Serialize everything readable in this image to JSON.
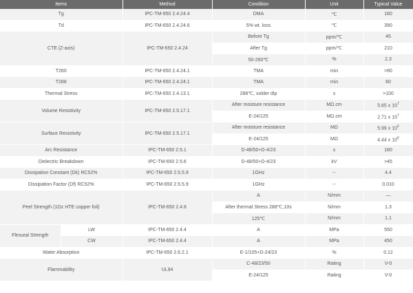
{
  "header": {
    "items": "Items",
    "method": "Method",
    "condition": "Condition",
    "unit": "Unit",
    "typical": "Typical Value"
  },
  "rows": {
    "tg": {
      "item": "Tg",
      "method": "IPC-TM-650 2.4.24.4",
      "condition": "DMA",
      "unit": "℃",
      "value": "180"
    },
    "td": {
      "item": "Td",
      "method": "IPC-TM-650 2.4.24.6",
      "condition": "5% wt. loss",
      "unit": "℃",
      "value": "390"
    },
    "cte": {
      "item": "CTE (Z-axis)",
      "method": "IPC-TM-650 2.4.24",
      "subs": [
        {
          "condition": "Before Tg",
          "unit": "ppm/℃",
          "value": "45"
        },
        {
          "condition": "After Tg",
          "unit": "ppm/℃",
          "value": "210"
        },
        {
          "condition": "50-260℃",
          "unit": "%",
          "value": "2.3"
        }
      ]
    },
    "t260": {
      "item": "T260",
      "method": "IPC-TM-650 2.4.24.1",
      "condition": "TMA",
      "unit": "min",
      "value": ">60"
    },
    "t288": {
      "item": "T288",
      "method": "IPC-TM-650 2.4.24.1",
      "condition": "TMA",
      "unit": "min",
      "value": "60"
    },
    "thermal": {
      "item": "Thermal Stress",
      "method": "IPC-TM-650 2.4.13.1",
      "condition": "288℃, solder dip",
      "unit": "s",
      "value": ">100"
    },
    "volume": {
      "item": "Volume Resistivity",
      "method": "IPC-TM-650 2.5.17.1",
      "subs": [
        {
          "condition": "After moisture resistance",
          "unit": "MΩ.cm",
          "value_base": "5.65 x 10",
          "value_exp": "7"
        },
        {
          "condition": "E-24/125",
          "unit": "MΩ.cm",
          "value_base": "2.71 x 10",
          "value_exp": "7"
        }
      ]
    },
    "surface": {
      "item": "Surface Resistivity",
      "method": "IPC-TM-650 2.5.17.1",
      "subs": [
        {
          "condition": "After moisture resistance",
          "unit": "MΩ",
          "value_base": "5.99 x 10",
          "value_exp": "6"
        },
        {
          "condition": "E-24/125",
          "unit": "MΩ",
          "value_base": "4.44 x 10",
          "value_exp": "6"
        }
      ]
    },
    "arc": {
      "item": "Arc Resistance",
      "method": "IPC-TM-650 2.5.1",
      "condition": "D-48/50+D-4/23",
      "unit": "s",
      "value": "180"
    },
    "dielectric": {
      "item": "Dielectric Breakdown",
      "method": "IPC-TM-650 2.5.6",
      "condition": "D-48/50+D-4/23",
      "unit": "kV",
      "value": ">45"
    },
    "dk": {
      "item": "Dissipation Constant (Dk) RC52%",
      "method": "IPC-TM-650 2.5.5.9",
      "condition": "1GHz",
      "unit": "--",
      "value": "4.4"
    },
    "df": {
      "item": "Dissipation Factor (Df) RC52%",
      "method": "IPC-TM-650 2.5.5.9",
      "condition": "1GHz",
      "unit": "--",
      "value": "0.010"
    },
    "peel": {
      "item": "Peel Strength (1Oz HTE copper foil)",
      "method": "IPC-TM-650 2.4.8",
      "subs": [
        {
          "condition": "A",
          "unit": "N/mm",
          "value": "—"
        },
        {
          "condition": "After thermal Stress 288℃,10s",
          "unit": "N/mm",
          "value": "1.3"
        },
        {
          "condition": "125℃",
          "unit": "N/mm",
          "value": "1.1"
        }
      ]
    },
    "flexural": {
      "item": "Flexural Strength",
      "subs": [
        {
          "dir": "LW",
          "method": "IPC-TM-650 2.4.4",
          "condition": "A",
          "unit": "MPa",
          "value": "550"
        },
        {
          "dir": "CW",
          "method": "IPC-TM-650 2.4.4",
          "condition": "A",
          "unit": "MPa",
          "value": "450"
        }
      ]
    },
    "water": {
      "item": "Water Absorption",
      "method": "IPC-TM-650 2.6.2.1",
      "condition": "E-1/105+D-24/23",
      "unit": "%",
      "value": "0.12"
    },
    "flam": {
      "item": "Flammability",
      "method": "UL94",
      "subs": [
        {
          "condition": "C-48/23/50",
          "unit": "Rating",
          "value": "V-0"
        },
        {
          "condition": "E-24/125",
          "unit": "Rating",
          "value": "V-0"
        }
      ]
    }
  }
}
